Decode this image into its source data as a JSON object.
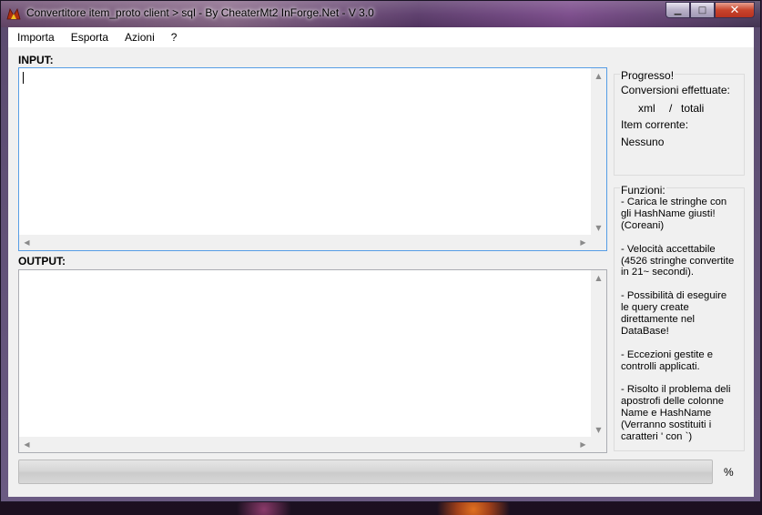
{
  "window": {
    "title": "Convertitore item_proto client > sql - By CheaterMt2 InForge.Net - V 3.0",
    "close_glyph": "✕",
    "minimize_glyph": "▁",
    "maximize_glyph": "□"
  },
  "menu": {
    "items": [
      "Importa",
      "Esporta",
      "Azioni",
      "?"
    ]
  },
  "input": {
    "label": "INPUT:",
    "value": ""
  },
  "output": {
    "label": "OUTPUT:",
    "value": ""
  },
  "progress_group": {
    "title": "Progresso!",
    "conversions_label": "Conversioni effettuate:",
    "xml_label": "xml",
    "separator": "/",
    "total_label": "totali",
    "current_item_label": "Item corrente:",
    "current_item_value": "Nessuno"
  },
  "functions_group": {
    "title": "Funzioni:",
    "items": [
      "- Carica le stringhe con gli HashName giusti! (Coreani)",
      "- Velocità accettabile (4526 stringhe convertite in 21~ secondi).",
      "- Possibilità di eseguire le query create direttamente nel DataBase!",
      "- Eccezioni gestite e controlli applicati.",
      "- Risolto il problema deli apostrofi delle colonne Name e HashName (Verranno sostituiti i caratteri ' con `)"
    ]
  },
  "progress": {
    "fraction": 0,
    "percent_label": "%"
  },
  "icons": {
    "app": "app-icon",
    "scroll_up": "▲",
    "scroll_down": "▼",
    "scroll_left": "◀",
    "scroll_right": "▶"
  }
}
